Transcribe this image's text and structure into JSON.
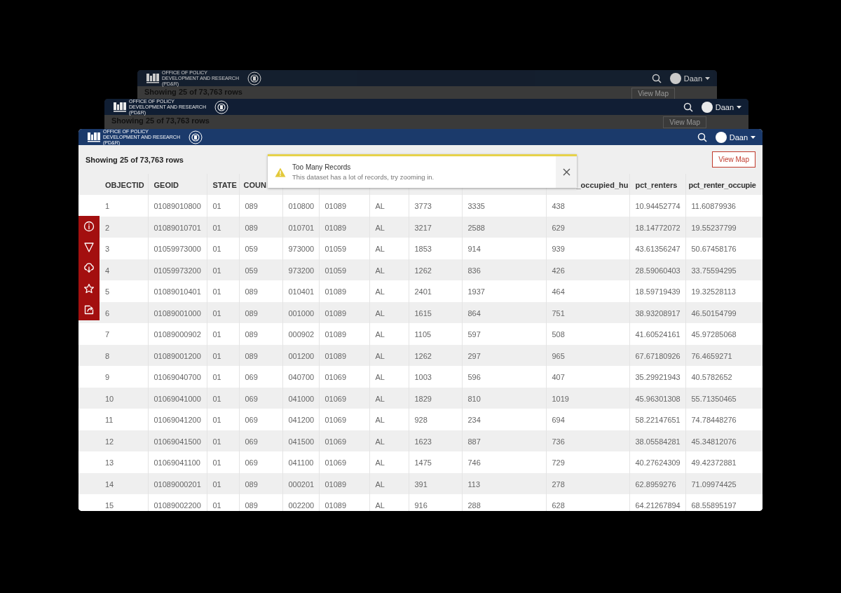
{
  "background_windows": [
    {
      "org_name": "OFFICE OF POLICY DEVELOPMENT AND RESEARCH (PD&R)",
      "user": "Daan",
      "heading": "Showing 25 of 73,763 rows",
      "button": "View Map"
    },
    {
      "org_name": "OFFICE OF POLICY DEVELOPMENT AND RESEARCH (PD&R)",
      "user": "Daan",
      "heading": "Showing 25 of 73,763 rows",
      "button": "View Map"
    }
  ],
  "header": {
    "org_name": "OFFICE OF POLICY DEVELOPMENT AND RESEARCH (PD&R)",
    "user": "Daan"
  },
  "summary": "Showing 25 of 73,763 rows",
  "view_map_button": "View Map",
  "toast": {
    "title": "Too Many Records",
    "message": "This dataset has a lot of records, try zooming in."
  },
  "table": {
    "columns": [
      "OBJECTID",
      "GEOID",
      "STATE",
      "COUN",
      null,
      null,
      null,
      null,
      null,
      "_occupied_hu",
      "pct_renters",
      "pct_renter_occupie"
    ],
    "rows": [
      [
        "1",
        "01089010800",
        "01",
        "089",
        "010800",
        "01089",
        "AL",
        "3773",
        "3335",
        "438",
        "10.94452774",
        "11.60879936"
      ],
      [
        "2",
        "01089010701",
        "01",
        "089",
        "010701",
        "01089",
        "AL",
        "3217",
        "2588",
        "629",
        "18.14772072",
        "19.55237799"
      ],
      [
        "3",
        "01059973000",
        "01",
        "059",
        "973000",
        "01059",
        "AL",
        "1853",
        "914",
        "939",
        "43.61356247",
        "50.67458176"
      ],
      [
        "4",
        "01059973200",
        "01",
        "059",
        "973200",
        "01059",
        "AL",
        "1262",
        "836",
        "426",
        "28.59060403",
        "33.75594295"
      ],
      [
        "5",
        "01089010401",
        "01",
        "089",
        "010401",
        "01089",
        "AL",
        "2401",
        "1937",
        "464",
        "18.59719439",
        "19.32528113"
      ],
      [
        "6",
        "01089001000",
        "01",
        "089",
        "001000",
        "01089",
        "AL",
        "1615",
        "864",
        "751",
        "38.93208917",
        "46.50154799"
      ],
      [
        "7",
        "01089000902",
        "01",
        "089",
        "000902",
        "01089",
        "AL",
        "1105",
        "597",
        "508",
        "41.60524161",
        "45.97285068"
      ],
      [
        "8",
        "01089001200",
        "01",
        "089",
        "001200",
        "01089",
        "AL",
        "1262",
        "297",
        "965",
        "67.67180926",
        "76.4659271"
      ],
      [
        "9",
        "01069040700",
        "01",
        "069",
        "040700",
        "01069",
        "AL",
        "1003",
        "596",
        "407",
        "35.29921943",
        "40.5782652"
      ],
      [
        "10",
        "01069041000",
        "01",
        "069",
        "041000",
        "01069",
        "AL",
        "1829",
        "810",
        "1019",
        "45.96301308",
        "55.71350465"
      ],
      [
        "11",
        "01069041200",
        "01",
        "069",
        "041200",
        "01069",
        "AL",
        "928",
        "234",
        "694",
        "58.22147651",
        "74.78448276"
      ],
      [
        "12",
        "01069041500",
        "01",
        "069",
        "041500",
        "01069",
        "AL",
        "1623",
        "887",
        "736",
        "38.05584281",
        "45.34812076"
      ],
      [
        "13",
        "01069041100",
        "01",
        "069",
        "041100",
        "01069",
        "AL",
        "1475",
        "746",
        "729",
        "40.27624309",
        "49.42372881"
      ],
      [
        "14",
        "01089000201",
        "01",
        "089",
        "000201",
        "01089",
        "AL",
        "391",
        "113",
        "278",
        "62.8959276",
        "71.09974425"
      ],
      [
        "15",
        "01089002200",
        "01",
        "089",
        "002200",
        "01089",
        "AL",
        "916",
        "288",
        "628",
        "64.21267894",
        "68.55895197"
      ]
    ]
  }
}
